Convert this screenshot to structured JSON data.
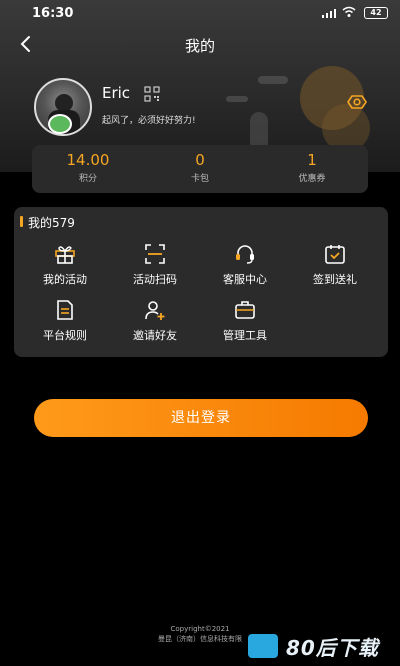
{
  "status_bar": {
    "time": "16:30",
    "battery": "42"
  },
  "nav": {
    "title": "我的"
  },
  "profile": {
    "name": "Eric",
    "signature": "起风了，必须好好努力!"
  },
  "stats": [
    {
      "value": "14.00",
      "label": "积分"
    },
    {
      "value": "0",
      "label": "卡包"
    },
    {
      "value": "1",
      "label": "优惠券"
    }
  ],
  "section": {
    "title": "我的579",
    "items": [
      {
        "label": "我的活动",
        "icon": "gift-icon"
      },
      {
        "label": "活动扫码",
        "icon": "scan-icon"
      },
      {
        "label": "客服中心",
        "icon": "headset-icon"
      },
      {
        "label": "签到送礼",
        "icon": "calendar-check-icon"
      },
      {
        "label": "平台规则",
        "icon": "document-icon"
      },
      {
        "label": "邀请好友",
        "icon": "add-user-icon"
      },
      {
        "label": "管理工具",
        "icon": "briefcase-icon"
      }
    ]
  },
  "logout": {
    "label": "退出登录"
  },
  "footer": {
    "copyright": "Copyright©2021",
    "company": "曼昆（济南）信息科技有限"
  },
  "watermark": {
    "text": "80后下载"
  },
  "colors": {
    "accent": "#f5a623",
    "button_start": "#ff9a1a",
    "button_end": "#f57a00",
    "panel": "#2b2b2b"
  }
}
